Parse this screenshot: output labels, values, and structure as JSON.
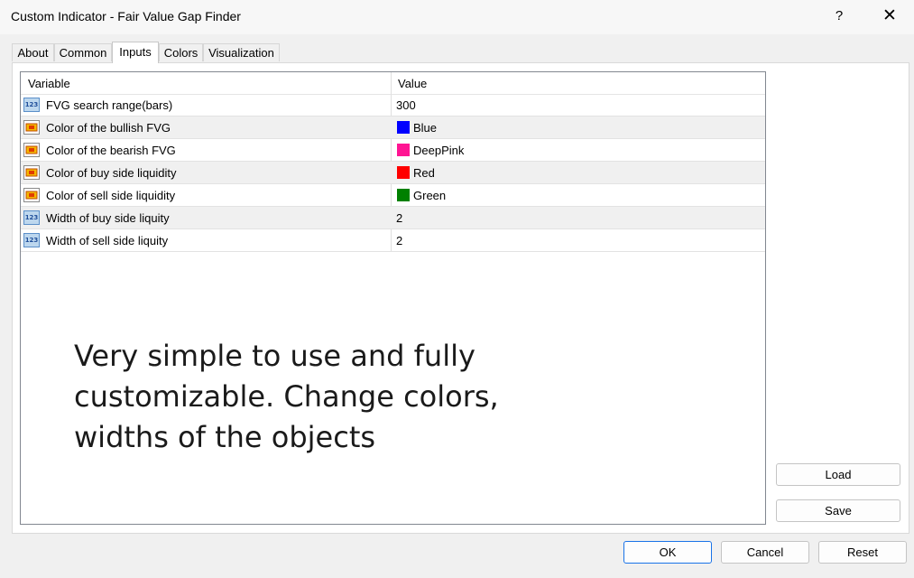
{
  "window": {
    "title": "Custom Indicator - Fair Value Gap Finder",
    "help_label": "?",
    "close_label": "✕"
  },
  "tabs": [
    {
      "label": "About"
    },
    {
      "label": "Common"
    },
    {
      "label": "Inputs"
    },
    {
      "label": "Colors"
    },
    {
      "label": "Visualization"
    }
  ],
  "active_tab": "Inputs",
  "grid": {
    "headers": {
      "variable": "Variable",
      "value": "Value"
    },
    "rows": [
      {
        "icon": "number-icon",
        "variable": "FVG search range(bars)",
        "value": "300"
      },
      {
        "icon": "color-icon",
        "variable": "Color of the bullish FVG",
        "value": "Blue",
        "swatch": "#0000ff"
      },
      {
        "icon": "color-icon",
        "variable": "Color of the bearish FVG",
        "value": "DeepPink",
        "swatch": "#ff1493"
      },
      {
        "icon": "color-icon",
        "variable": "Color of buy side liquidity",
        "value": "Red",
        "swatch": "#ff0000"
      },
      {
        "icon": "color-icon",
        "variable": "Color of sell side liquidity",
        "value": "Green",
        "swatch": "#008000"
      },
      {
        "icon": "number-icon",
        "variable": "Width of buy side liquity",
        "value": "2"
      },
      {
        "icon": "number-icon",
        "variable": "Width of sell side liquity",
        "value": "2"
      }
    ]
  },
  "overlay_text": {
    "line1": "Very simple to use and fully",
    "line2": "customizable. Change colors,",
    "line3": "widths of the objects"
  },
  "side_buttons": {
    "load": "Load",
    "save": "Save"
  },
  "footer_buttons": {
    "ok": "OK",
    "cancel": "Cancel",
    "reset": "Reset"
  },
  "number_icon_text": "123"
}
